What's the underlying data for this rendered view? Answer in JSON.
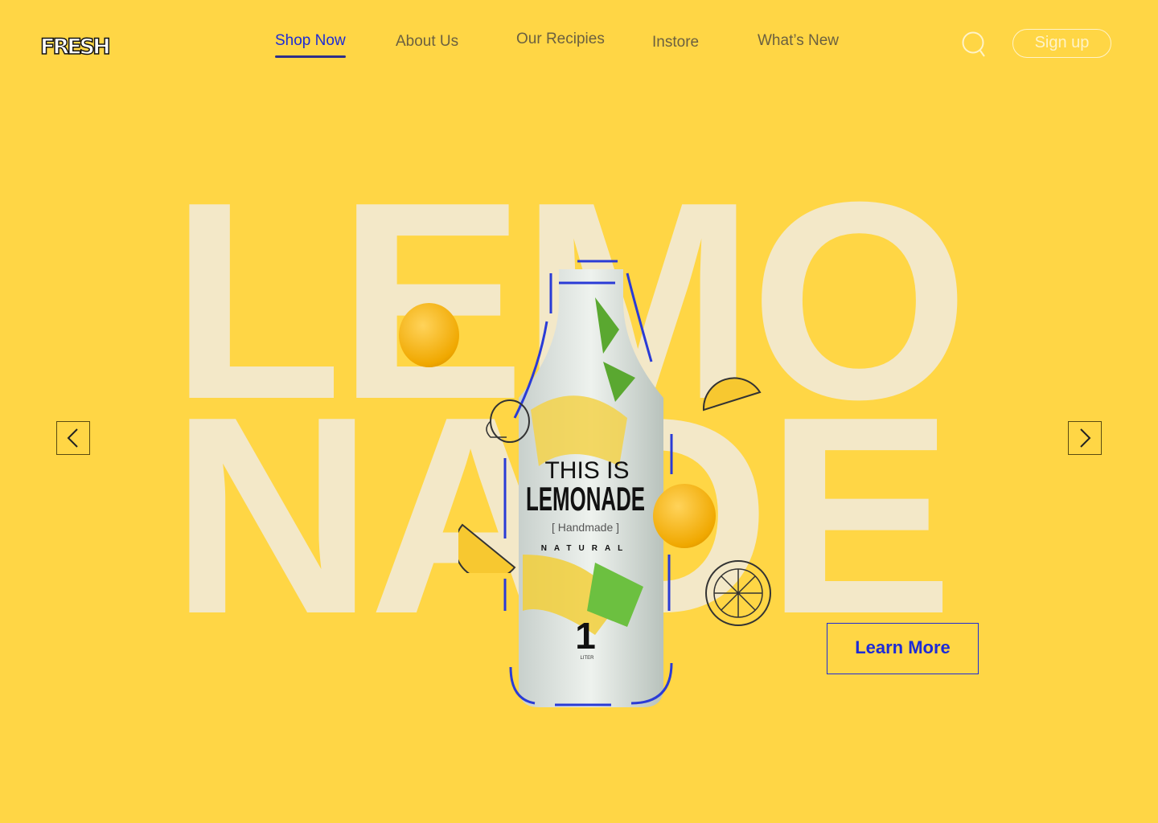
{
  "logo": "FRESH",
  "nav": [
    {
      "label": "Shop Now",
      "active": true
    },
    {
      "label": "About Us"
    },
    {
      "label": "Our Recipies"
    },
    {
      "label": "Instore"
    },
    {
      "label": "What’s New"
    }
  ],
  "header": {
    "signup_label": "Sign up",
    "search_icon": "search-icon"
  },
  "hero": {
    "row1": "LEMO",
    "row2": "NADE",
    "cta": "Learn More",
    "bottle_label": {
      "line1": "THIS IS",
      "line2": "LEMONADE",
      "line3": "[ Handmade ]",
      "line4": "NATURAL",
      "volume": "1",
      "unit": "LITER"
    }
  },
  "colors": {
    "background": "#FFD645",
    "accent": "#1d2bd6",
    "big_text": "#F3E8C8"
  }
}
